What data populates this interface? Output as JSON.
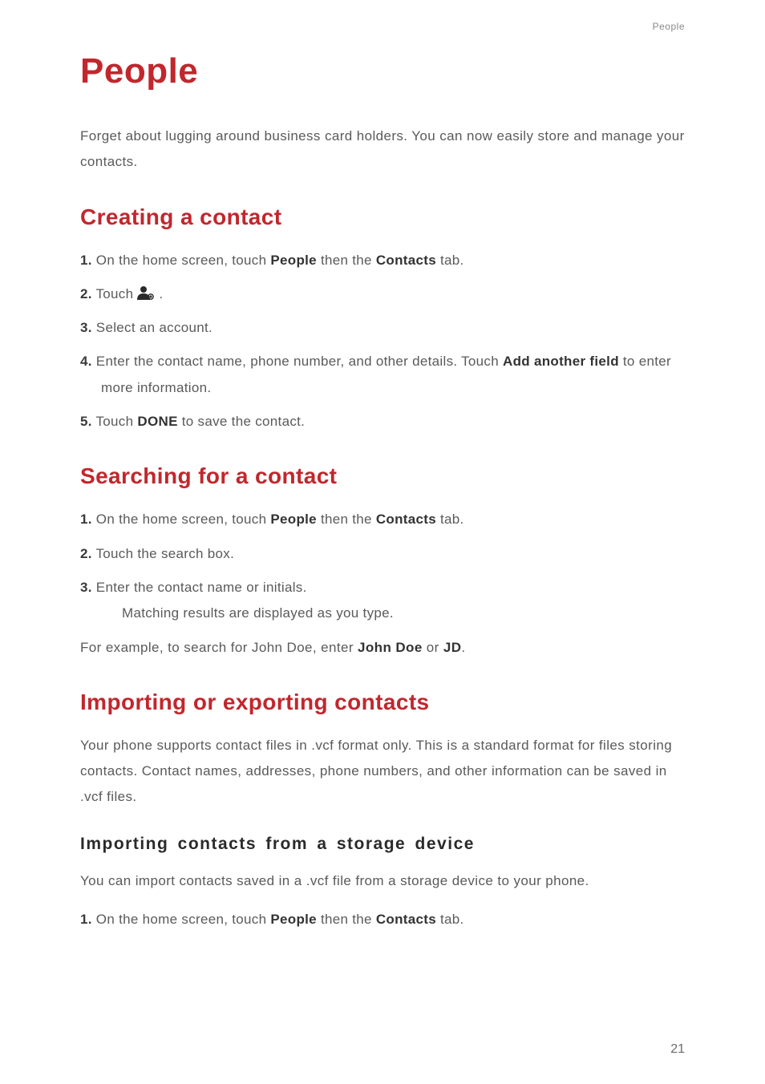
{
  "running_head": "People",
  "title": "People",
  "intro": "Forget about lugging around business card holders. You can now easily store and manage your contacts.",
  "section_creating": {
    "heading": "Creating a contact",
    "step1_num": "1.",
    "step1_a": " On the home screen, touch ",
    "step1_b_bold": "People",
    "step1_c": " then the ",
    "step1_d_bold": "Contacts",
    "step1_e": " tab.",
    "step2_num": "2.",
    "step2_a": " Touch ",
    "step2_b": ".",
    "step3_num": "3.",
    "step3_a": " Select an account.",
    "step4_num": "4.",
    "step4_a": " Enter the contact name, phone number, and other details. Touch ",
    "step4_b_bold": "Add another field",
    "step4_c": " to enter more information.",
    "step5_num": "5.",
    "step5_a": " Touch ",
    "step5_b_bold": "DONE",
    "step5_c": " to save the contact."
  },
  "section_searching": {
    "heading": "Searching for a contact",
    "step1_num": "1.",
    "step1_a": " On the home screen, touch ",
    "step1_b_bold": "People",
    "step1_c": " then the ",
    "step1_d_bold": "Contacts",
    "step1_e": " tab.",
    "step2_num": "2.",
    "step2_a": " Touch the search box.",
    "step3_num": "3.",
    "step3_a": " Enter the contact name or initials.",
    "step3_sub": "Matching results are displayed as you type.",
    "example_a": "For example, to search for John Doe, enter ",
    "example_b_bold": "John Doe",
    "example_c": " or ",
    "example_d_bold": "JD",
    "example_e": "."
  },
  "section_import": {
    "heading": "Importing or exporting contacts",
    "body": "Your phone supports contact files in .vcf format only. This is a standard format for files storing contacts. Contact names, addresses, phone numbers, and other information can be saved in .vcf files.",
    "sub_heading": "Importing contacts from a storage device",
    "sub_body": "You can import contacts saved in a .vcf file from a storage device to your phone.",
    "step1_num": "1.",
    "step1_a": " On the home screen, touch ",
    "step1_b_bold": "People",
    "step1_c": " then the ",
    "step1_d_bold": "Contacts",
    "step1_e": " tab."
  },
  "page_number": "21"
}
